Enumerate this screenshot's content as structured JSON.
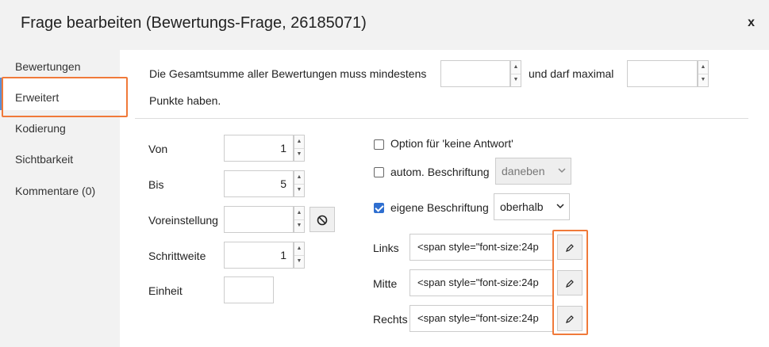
{
  "dialog": {
    "title": "Frage bearbeiten (Bewertungs-Frage, 26185071)",
    "close_label": "x"
  },
  "sidebar": {
    "items": [
      {
        "label": "Bewertungen"
      },
      {
        "label": "Erweitert"
      },
      {
        "label": "Kodierung"
      },
      {
        "label": "Sichtbarkeit"
      },
      {
        "label": "Kommentare (0)"
      }
    ]
  },
  "sum": {
    "min_label": "Die Gesamtsumme aller Bewertungen muss mindestens",
    "min_value": "",
    "max_label": "und darf maximal",
    "max_value": "",
    "suffix": "Punkte haben."
  },
  "fields": {
    "von": {
      "label": "Von",
      "value": "1"
    },
    "bis": {
      "label": "Bis",
      "value": "5"
    },
    "voreinstellung": {
      "label": "Voreinstellung",
      "value": ""
    },
    "schrittweite": {
      "label": "Schrittweite",
      "value": "1"
    },
    "einheit": {
      "label": "Einheit",
      "value": ""
    }
  },
  "options": {
    "keine_antwort": {
      "label": "Option für 'keine Antwort'",
      "checked": false
    },
    "autom": {
      "label": "autom. Beschriftung",
      "checked": false,
      "select": "daneben"
    },
    "eigene": {
      "label": "eigene Beschriftung",
      "checked": true,
      "select": "oberhalb"
    }
  },
  "labels": {
    "links": {
      "label": "Links",
      "value": "<span style=\"font-size:24p"
    },
    "mitte": {
      "label": "Mitte",
      "value": "<span style=\"font-size:24p"
    },
    "rechts": {
      "label": "Rechts",
      "value": "<span style=\"font-size:24p"
    }
  },
  "icons": {
    "reset": "clear-icon",
    "edit": "pencil-icon",
    "up": "▲",
    "down": "▼",
    "chevron": "⌄"
  }
}
